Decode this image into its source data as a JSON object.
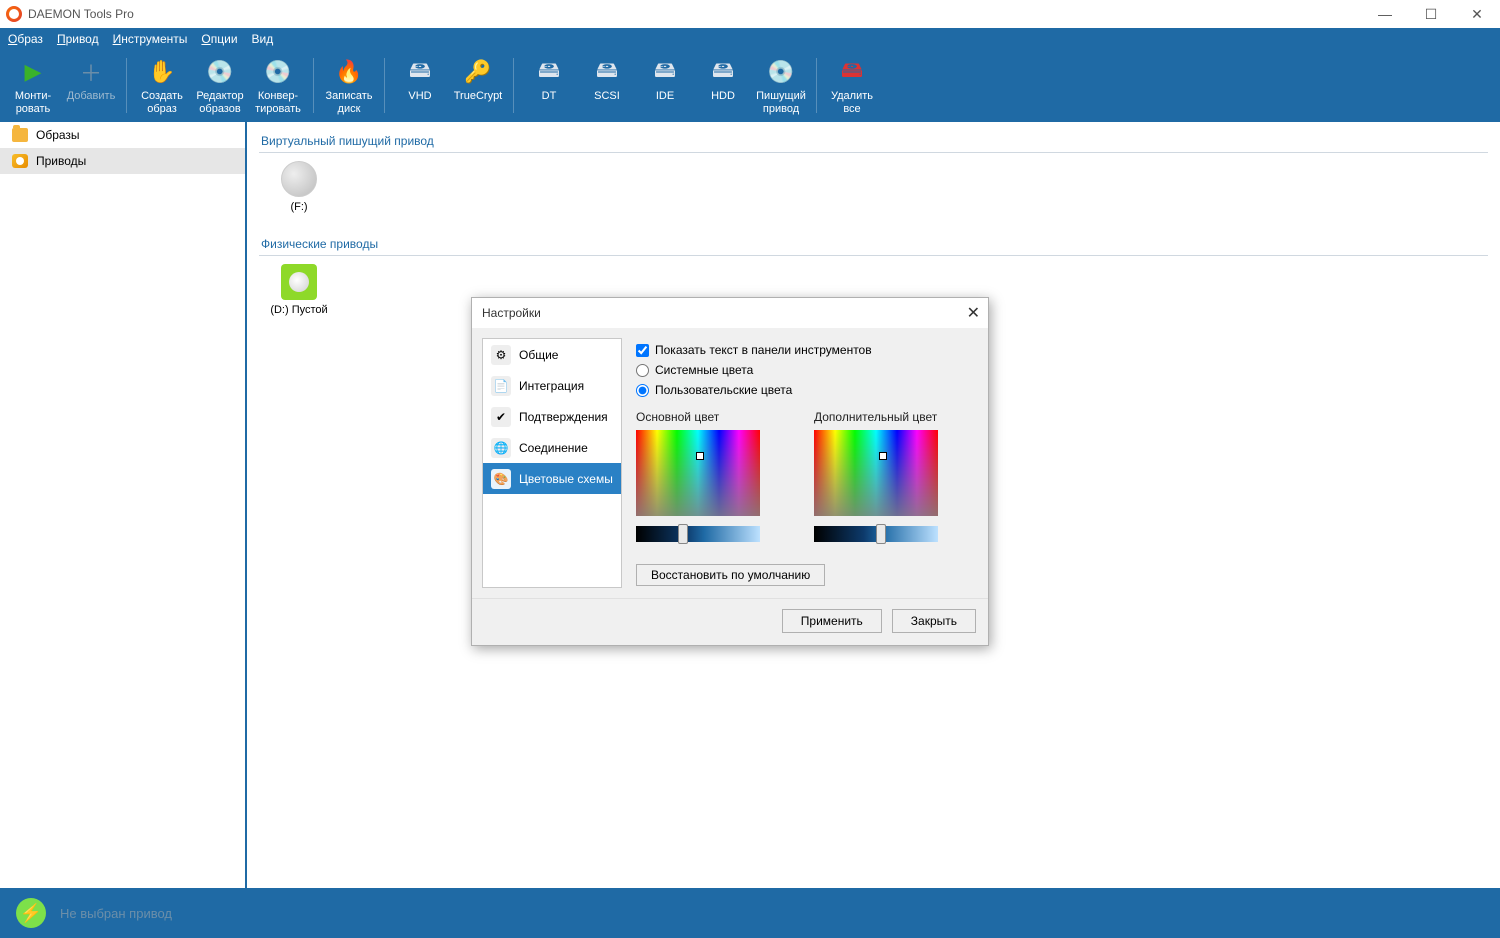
{
  "app": {
    "title": "DAEMON Tools Pro"
  },
  "menu": {
    "items": [
      "Образ",
      "Привод",
      "Инструменты",
      "Опции",
      "Вид"
    ]
  },
  "toolbar": {
    "groups": [
      [
        {
          "name": "mount",
          "label": "Монти-\nровать",
          "icon": "▶",
          "cls": "ico-play"
        },
        {
          "name": "add",
          "label": "Добавить",
          "icon": "＋",
          "cls": "ico-plus",
          "disabled": true
        }
      ],
      [
        {
          "name": "create-image",
          "label": "Создать\nобраз",
          "icon": "✋",
          "cls": "ico-hand"
        },
        {
          "name": "image-editor",
          "label": "Редактор\nобразов",
          "icon": "💿",
          "cls": "ico-disc"
        },
        {
          "name": "convert",
          "label": "Конвер-\nтировать",
          "icon": "💿",
          "cls": "ico-disc"
        }
      ],
      [
        {
          "name": "burn",
          "label": "Записать\nдиск",
          "icon": "🔥",
          "cls": "ico-fire"
        }
      ],
      [
        {
          "name": "vhd",
          "label": "VHD",
          "icon": "🖴",
          "cls": "ico-drive"
        },
        {
          "name": "truecrypt",
          "label": "TrueCrypt",
          "icon": "🔑",
          "cls": "ico-key"
        }
      ],
      [
        {
          "name": "dt",
          "label": "DT",
          "icon": "🖴",
          "cls": "ico-drive"
        },
        {
          "name": "scsi",
          "label": "SCSI",
          "icon": "🖴",
          "cls": "ico-drive"
        },
        {
          "name": "ide",
          "label": "IDE",
          "icon": "🖴",
          "cls": "ico-drive"
        },
        {
          "name": "hdd",
          "label": "HDD",
          "icon": "🖴",
          "cls": "ico-drive"
        },
        {
          "name": "writer",
          "label": "Пишущий\nпривод",
          "icon": "💿",
          "cls": "ico-disc"
        }
      ],
      [
        {
          "name": "delete-all",
          "label": "Удалить\nвсе",
          "icon": "🖴",
          "cls": "ico-del"
        }
      ]
    ]
  },
  "sidebar": {
    "items": [
      {
        "name": "images",
        "label": "Образы",
        "icon": "folder"
      },
      {
        "name": "drives",
        "label": "Приводы",
        "icon": "disc",
        "selected": true
      }
    ]
  },
  "main": {
    "section1": {
      "title": "Виртуальный пишущий привод",
      "drive_label": "(F:)"
    },
    "section2": {
      "title": "Физические приводы",
      "drive_label": "(D:) Пустой"
    }
  },
  "status": {
    "text": "Не выбран привод"
  },
  "dialog": {
    "title": "Настройки",
    "nav": [
      {
        "name": "general",
        "label": "Общие",
        "icon": "⚙"
      },
      {
        "name": "integration",
        "label": "Интеграция",
        "icon": "📄"
      },
      {
        "name": "confirmations",
        "label": "Подтверждения",
        "icon": "✔"
      },
      {
        "name": "connection",
        "label": "Соединение",
        "icon": "🌐"
      },
      {
        "name": "color-schemes",
        "label": "Цветовые схемы",
        "icon": "🎨",
        "selected": true
      }
    ],
    "opts": {
      "show_text_label": "Показать текст в панели инструментов",
      "system_colors_label": "Системные цвета",
      "custom_colors_label": "Пользовательские цвета"
    },
    "pickers": {
      "primary_label": "Основной цвет",
      "secondary_label": "Дополнительный цвет"
    },
    "restore_label": "Восстановить по умолчанию",
    "apply_label": "Применить",
    "close_label": "Закрыть"
  }
}
